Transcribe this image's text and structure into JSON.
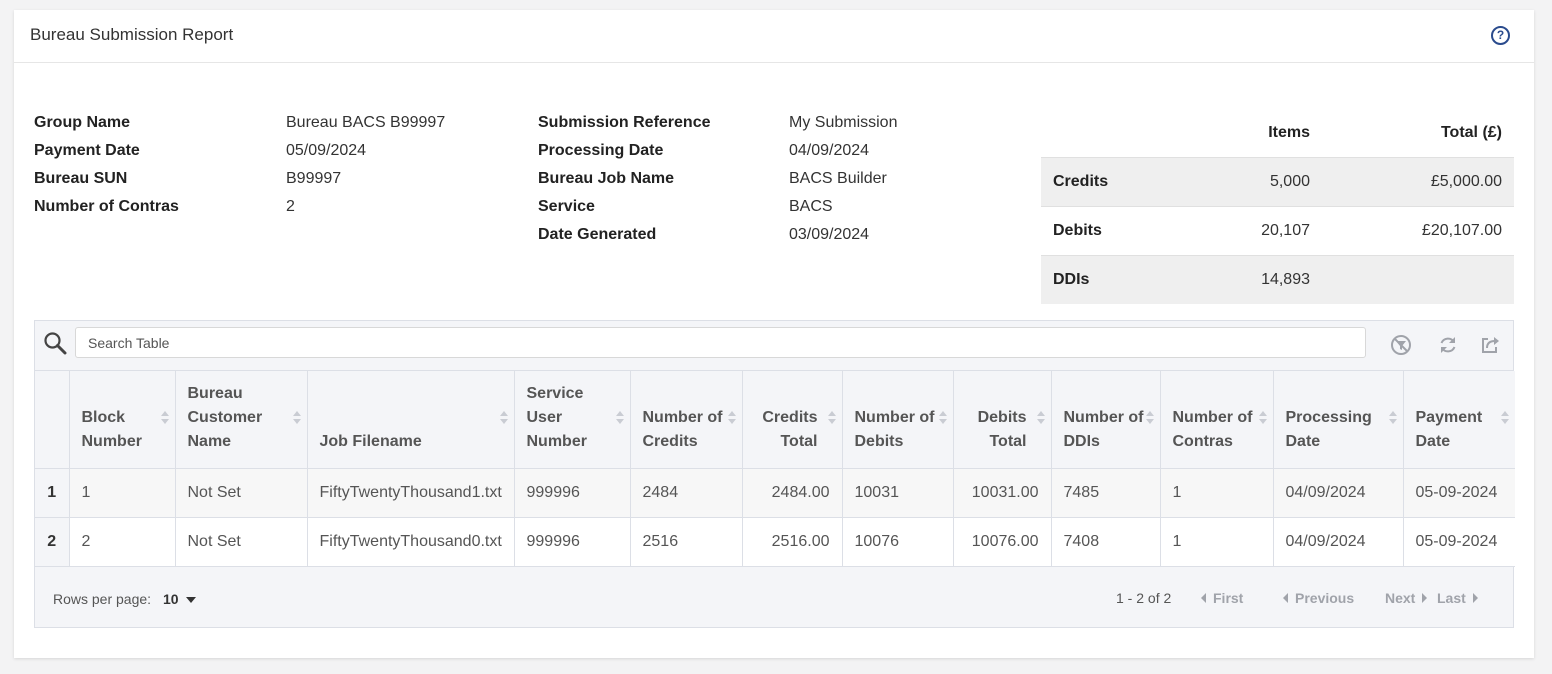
{
  "header": {
    "title": "Bureau Submission Report",
    "help_icon": "?"
  },
  "info_left": [
    {
      "label": "Group Name",
      "value": "Bureau BACS B99997"
    },
    {
      "label": "Payment Date",
      "value": "05/09/2024"
    },
    {
      "label": "Bureau SUN",
      "value": "B99997"
    },
    {
      "label": "Number of Contras",
      "value": "2"
    }
  ],
  "info_mid": [
    {
      "label": "Submission Reference",
      "value": "My Submission"
    },
    {
      "label": "Processing Date",
      "value": "04/09/2024"
    },
    {
      "label": "Bureau Job Name",
      "value": "BACS Builder"
    },
    {
      "label": "Service",
      "value": "BACS"
    },
    {
      "label": "Date Generated",
      "value": "03/09/2024"
    }
  ],
  "summary": {
    "headers": [
      "",
      "Items",
      "Total (£)"
    ],
    "rows": [
      {
        "label": "Credits",
        "items": "5,000",
        "total": "£5,000.00"
      },
      {
        "label": "Debits",
        "items": "20,107",
        "total": "£20,107.00"
      },
      {
        "label": "DDIs",
        "items": "14,893",
        "total": ""
      }
    ]
  },
  "table": {
    "search_placeholder": "Search Table",
    "columns": [
      "",
      "Block Number",
      "Bureau Customer Name",
      "Job Filename",
      "Service User Number",
      "Number of Credits",
      "Credits Total",
      "Number of Debits",
      "Debits Total",
      "Number of DDIs",
      "Number of Contras",
      "Processing Date",
      "Payment Date"
    ],
    "rows": [
      [
        "1",
        "1",
        "Not Set",
        "FiftyTwentyThousand1.txt",
        "999996",
        "2484",
        "2484.00",
        "10031",
        "10031.00",
        "7485",
        "1",
        "04/09/2024",
        "05-09-2024"
      ],
      [
        "2",
        "2",
        "Not Set",
        "FiftyTwentyThousand0.txt",
        "999996",
        "2516",
        "2516.00",
        "10076",
        "10076.00",
        "7408",
        "1",
        "04/09/2024",
        "05-09-2024"
      ]
    ]
  },
  "footer": {
    "rows_per_page_label": "Rows per page:",
    "rows_per_page_value": "10",
    "page_info": "1 - 2 of 2",
    "first": "First",
    "previous": "Previous",
    "next": "Next",
    "last": "Last"
  },
  "colors": {
    "accent": "#2a4b8d",
    "muted": "#a0a3aa",
    "grid_bg": "#f4f5f8"
  }
}
